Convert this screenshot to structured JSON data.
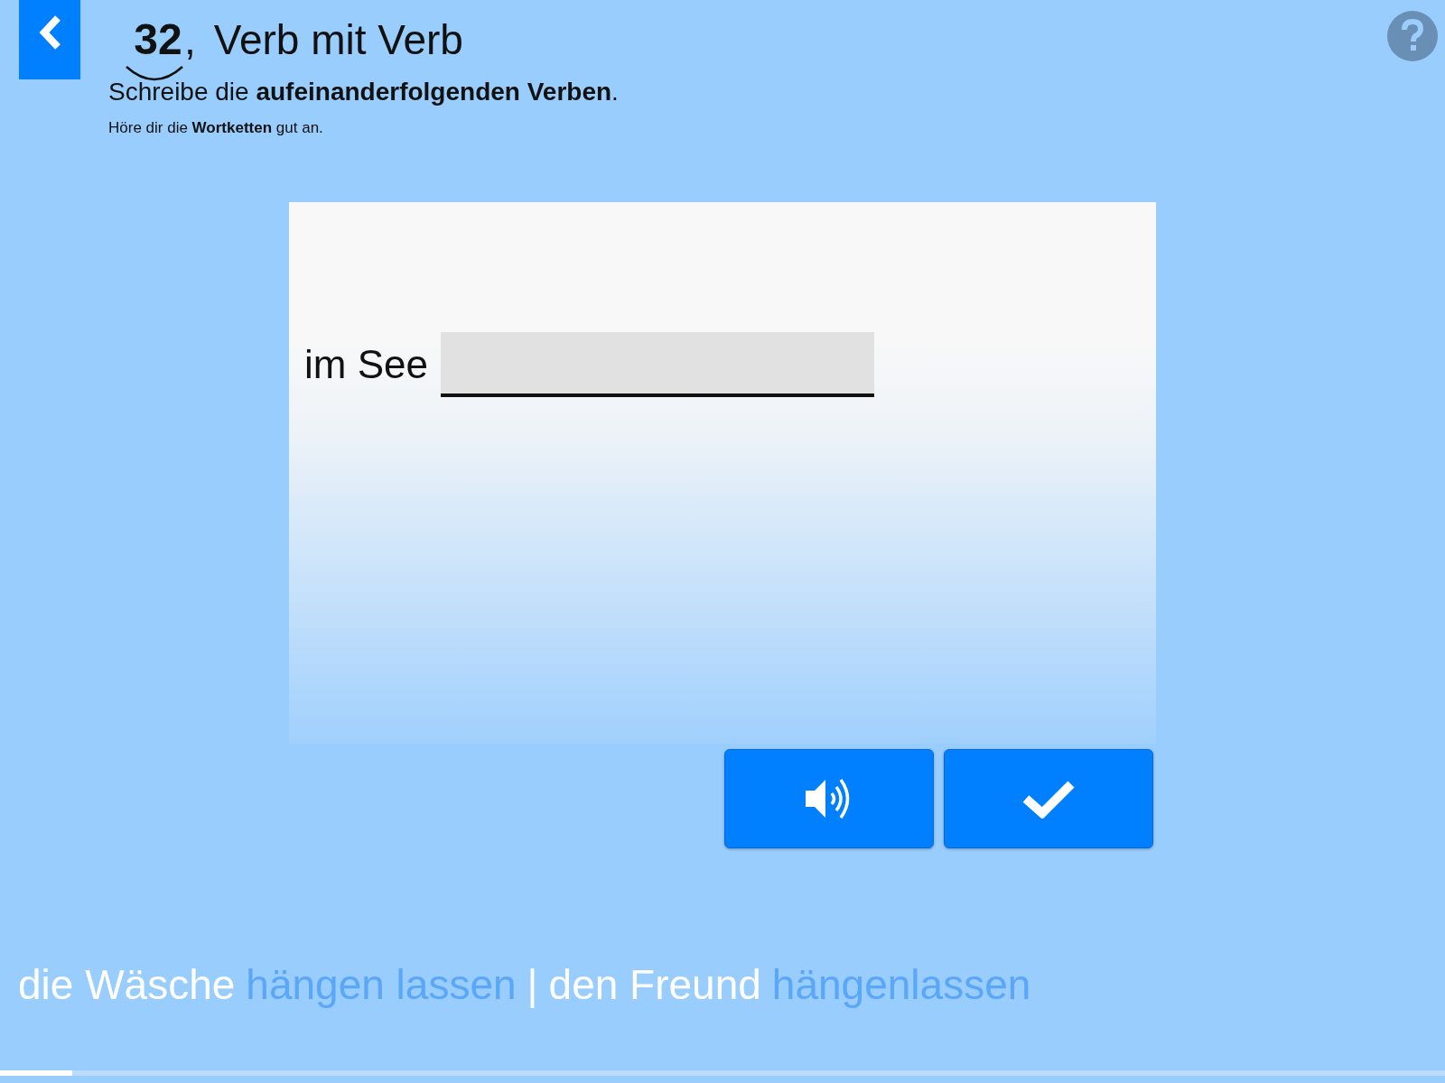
{
  "exercise": {
    "number": "32",
    "separator": ",",
    "title": "Verb mit Verb"
  },
  "instruction": "Schreibe die **aufeinanderfolgenden Verben**.",
  "hint": "Höre dir die **Wortketten** gut an.",
  "task": {
    "prompt": "im See"
  },
  "buttons": [
    {
      "kind": "audio"
    },
    {
      "kind": "check"
    }
  ],
  "word_chain": [
    {
      "kind": "phrase",
      "text": "die Wäsche"
    },
    {
      "kind": "answer",
      "text": "hängen lassen"
    },
    {
      "kind": "divider",
      "text": "|"
    },
    {
      "kind": "phrase",
      "text": "den Freund"
    },
    {
      "kind": "answer",
      "text": "hängenlassen"
    }
  ],
  "progress": {
    "level": 0.05
  }
}
